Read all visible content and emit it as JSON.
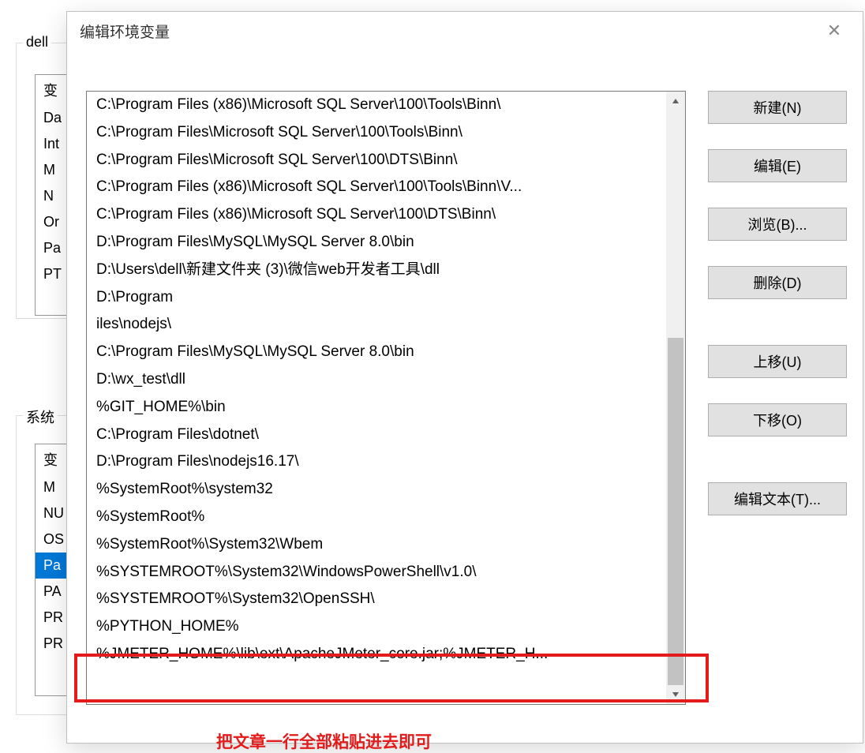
{
  "bg": {
    "user_group_label": "dell",
    "user_list": [
      "变",
      "Da",
      "Int",
      "M",
      "N",
      "Or",
      "Pa",
      "PT"
    ],
    "sys_group_label": "系统",
    "sys_list": [
      "变",
      "M",
      "NU",
      "OS",
      "Pa",
      "PA",
      "PR",
      "PR"
    ],
    "sys_selected_index": 4
  },
  "dialog": {
    "title": "编辑环境变量",
    "paths": [
      "C:\\Program Files (x86)\\Microsoft SQL Server\\100\\Tools\\Binn\\",
      "C:\\Program Files\\Microsoft SQL Server\\100\\Tools\\Binn\\",
      "C:\\Program Files\\Microsoft SQL Server\\100\\DTS\\Binn\\",
      "C:\\Program Files (x86)\\Microsoft SQL Server\\100\\Tools\\Binn\\V...",
      "C:\\Program Files (x86)\\Microsoft SQL Server\\100\\DTS\\Binn\\",
      "D:\\Program Files\\MySQL\\MySQL Server 8.0\\bin",
      "D:\\Users\\dell\\新建文件夹 (3)\\微信web开发者工具\\dll",
      "D:\\Program",
      "iles\\nodejs\\",
      "C:\\Program Files\\MySQL\\MySQL Server 8.0\\bin",
      "D:\\wx_test\\dll",
      "%GIT_HOME%\\bin",
      "C:\\Program Files\\dotnet\\",
      "D:\\Program Files\\nodejs16.17\\",
      "%SystemRoot%\\system32",
      "%SystemRoot%",
      "%SystemRoot%\\System32\\Wbem",
      "%SYSTEMROOT%\\System32\\WindowsPowerShell\\v1.0\\",
      "%SYSTEMROOT%\\System32\\OpenSSH\\",
      "%PYTHON_HOME%",
      "%JMETER_HOME%\\lib\\ext\\ApacheJMeter_core.jar;%JMETER_H..."
    ],
    "buttons": {
      "new": "新建(N)",
      "edit": "编辑(E)",
      "browse": "浏览(B)...",
      "delete": "删除(D)",
      "move_up": "上移(U)",
      "move_down": "下移(O)",
      "edit_text": "编辑文本(T)..."
    }
  },
  "annotation": "把文章一行全部粘贴进去即可"
}
